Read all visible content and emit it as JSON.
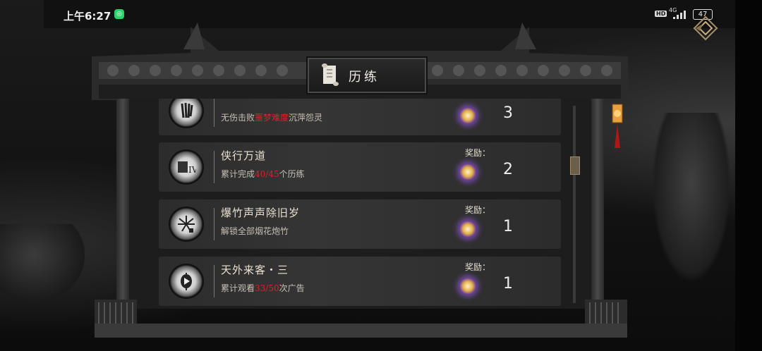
{
  "status_bar": {
    "time": "上午6:27",
    "hd": "HD",
    "network": "4G",
    "battery": "47"
  },
  "header": {
    "title": "历练"
  },
  "achievements": [
    {
      "title": "",
      "desc_pre": "无伤击败",
      "desc_hl": "噩梦难度",
      "desc_post": "沉萍怨灵",
      "reward_label": "",
      "reward_count": "3",
      "icon": "claw-icon"
    },
    {
      "title": "侠行万道",
      "desc_pre": "累计完成",
      "desc_hl": "40/45",
      "desc_post": "个历练",
      "reward_label": "奖励：",
      "reward_count": "2",
      "icon": "books-iv-icon"
    },
    {
      "title": "爆竹声声除旧岁",
      "desc_pre": "解锁全部烟花炮竹",
      "desc_hl": "",
      "desc_post": "",
      "reward_label": "奖励：",
      "reward_count": "1",
      "icon": "firework-icon"
    },
    {
      "title": "天外来客・三",
      "desc_pre": "累计观看",
      "desc_hl": "33/50",
      "desc_post": "次广告",
      "reward_label": "奖励：",
      "reward_count": "1",
      "icon": "video-lantern-icon"
    }
  ]
}
